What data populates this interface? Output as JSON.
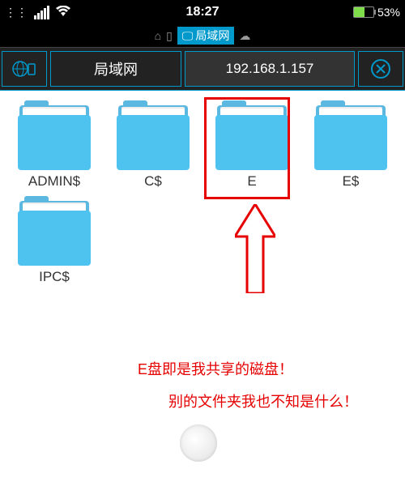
{
  "status": {
    "time": "18:27",
    "battery": "53%"
  },
  "breadcrumb": {
    "lan_label": "局域网"
  },
  "nav": {
    "lan_label": "局域网",
    "ip": "192.168.1.157"
  },
  "folders": [
    {
      "name": "ADMIN$"
    },
    {
      "name": "C$"
    },
    {
      "name": "E"
    },
    {
      "name": "E$"
    },
    {
      "name": "IPC$"
    }
  ],
  "annotations": {
    "line1": "E盘即是我共享的磁盘！",
    "line2": "别的文件夹我也不知是什么！"
  }
}
